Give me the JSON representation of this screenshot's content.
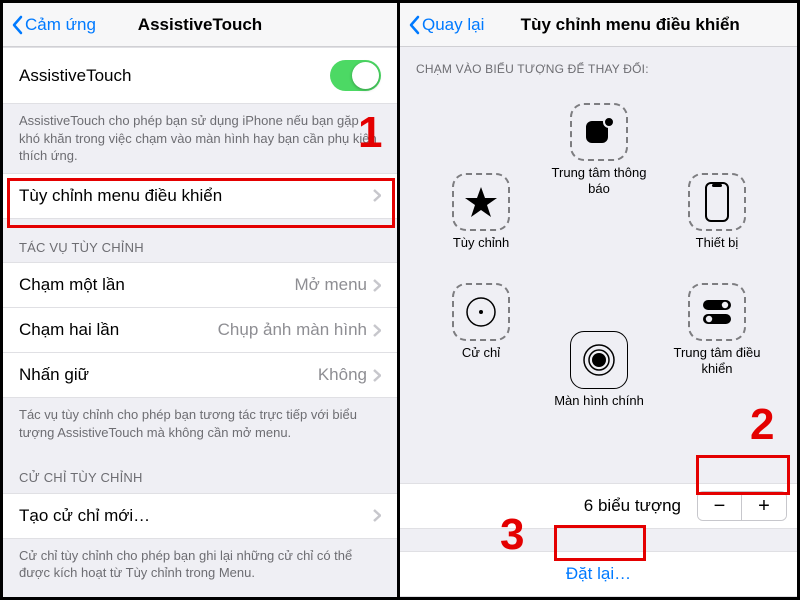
{
  "annotations": {
    "n1": "1",
    "n2": "2",
    "n3": "3"
  },
  "left": {
    "nav_back": "Cảm ứng",
    "nav_title": "AssistiveTouch",
    "toggle_label": "AssistiveTouch",
    "toggle_on": true,
    "desc1": "AssistiveTouch cho phép bạn sử dụng iPhone nếu bạn gặp khó khăn trong việc chạm vào màn hình hay bạn cần phụ kiện thích ứng.",
    "customize_label": "Tùy chỉnh menu điều khiển",
    "section_custom": "TÁC VỤ TÙY CHỈNH",
    "tap1": {
      "label": "Chạm một lần",
      "value": "Mở menu"
    },
    "tap2": {
      "label": "Chạm hai lần",
      "value": "Chụp ảnh màn hình"
    },
    "hold": {
      "label": "Nhấn giữ",
      "value": "Không"
    },
    "desc2": "Tác vụ tùy chỉnh cho phép bạn tương tác trực tiếp với biểu tượng AssistiveTouch mà không cần mở menu.",
    "section_gesture": "CỬ CHỈ TÙY CHỈNH",
    "gesture_label": "Tạo cử chỉ mới…",
    "desc3": "Cử chỉ tùy chỉnh cho phép bạn ghi lại những cử chỉ có thể được kích hoạt từ Tùy chỉnh trong Menu."
  },
  "right": {
    "nav_back": "Quay lại",
    "nav_title": "Tùy chỉnh menu điều khiển",
    "hint": "CHẠM VÀO BIỂU TƯỢNG ĐỂ THAY ĐỔI:",
    "icons": {
      "notif": "Trung tâm thông báo",
      "custom": "Tùy chỉnh",
      "device": "Thiết bị",
      "gesture": "Cử chỉ",
      "control": "Trung tâm điều khiển",
      "home": "Màn hình chính"
    },
    "count_text": "6 biểu tượng",
    "minus": "−",
    "plus": "+",
    "reset": "Đặt lại…"
  }
}
